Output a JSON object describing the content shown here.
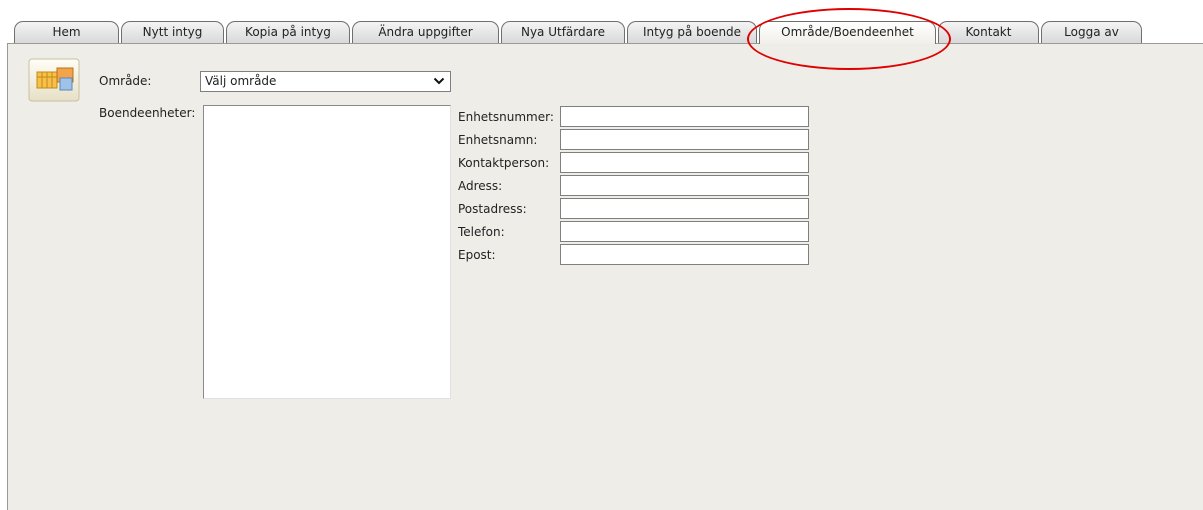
{
  "tabs": [
    {
      "label": "Hem"
    },
    {
      "label": "Nytt intyg"
    },
    {
      "label": "Kopia på intyg"
    },
    {
      "label": "Ändra uppgifter"
    },
    {
      "label": "Nya Utfärdare"
    },
    {
      "label": "Intyg på boende"
    },
    {
      "label": "Område/Boendeenhet"
    },
    {
      "label": "Kontakt"
    },
    {
      "label": "Logga av"
    }
  ],
  "area": {
    "label": "Område:",
    "selected": "Välj område"
  },
  "units": {
    "label": "Boendeenheter:"
  },
  "form": {
    "unit_number_label": "Enhetsnummer:",
    "unit_name_label": "Enhetsnamn:",
    "contact_person_label": "Kontaktperson:",
    "address_label": "Adress:",
    "postal_address_label": "Postadress:",
    "phone_label": "Telefon:",
    "email_label": "Epost:"
  },
  "colors": {
    "panel_bg": "#efede8",
    "highlight": "#e00000"
  },
  "icons": {
    "app": "grid-folder-icon",
    "dropdown": "chevron-down-icon"
  }
}
